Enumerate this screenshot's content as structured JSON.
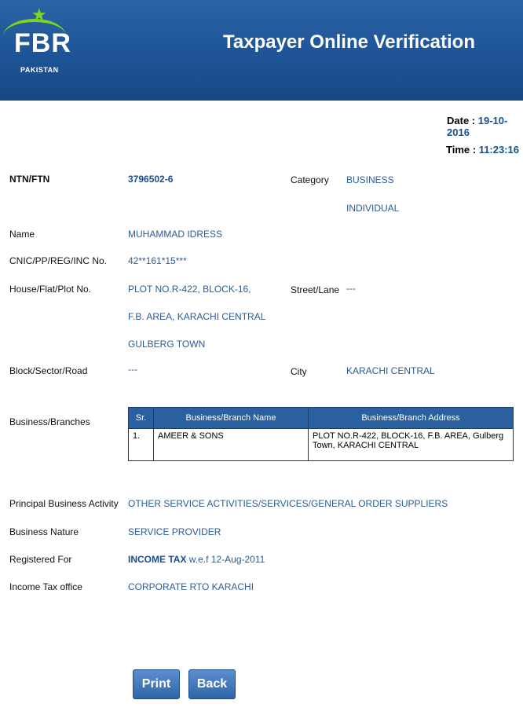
{
  "header": {
    "logo_text": "FBR",
    "logo_sub": "PAKISTAN",
    "title": "Taxpayer Online Verification",
    "colors": {
      "background": "#1d5394",
      "logo_accent": "#7ed321"
    }
  },
  "meta": {
    "date_label": "Date :",
    "date_value": "19-10-2016",
    "time_label": "Time :",
    "time_value": "11:23:16"
  },
  "fields": {
    "ntn_label": "NTN/FTN",
    "ntn_value": "3796502-6",
    "category_label": "Category",
    "category_line1": "BUSINESS",
    "category_line2": "INDIVIDUAL",
    "name_label": "Name",
    "name_value": "MUHAMMAD IDRESS",
    "cnic_label": "CNIC/PP/REG/INC No.",
    "cnic_value": "42**161*15***",
    "house_label": "House/Flat/Plot No.",
    "house_line1": "PLOT NO.R-422, BLOCK-16,",
    "house_line2": "F.B. AREA, KARACHI CENTRAL",
    "house_line3": "GULBERG TOWN",
    "street_label": "Street/Lane",
    "street_value": "---",
    "block_label": "Block/Sector/Road",
    "block_value": "---",
    "city_label": "City",
    "city_value": "KARACHI CENTRAL",
    "branches_label": "Business/Branches",
    "activity_label": "Principal Business Activity",
    "activity_value": "OTHER SERVICE ACTIVITIES/SERVICES/GENERAL ORDER SUPPLIERS",
    "nature_label": "Business Nature",
    "nature_value": "SERVICE PROVIDER",
    "registered_label": "Registered For",
    "registered_bold": "INCOME TAX",
    "registered_rest": " w.e.f 12-Aug-2011",
    "office_label": "Income Tax office",
    "office_value": "CORPORATE RTO KARACHI"
  },
  "branches_table": {
    "headers": [
      "Sr.",
      "Business/Branch Name",
      "Business/Branch Address"
    ],
    "rows": [
      {
        "sr": "1.",
        "name": "AMEER & SONS",
        "address": "PLOT NO.R-422, BLOCK-16, F.B. AREA, Gulberg Town, KARACHI CENTRAL"
      }
    ]
  },
  "buttons": {
    "print": "Print",
    "back": "Back"
  }
}
